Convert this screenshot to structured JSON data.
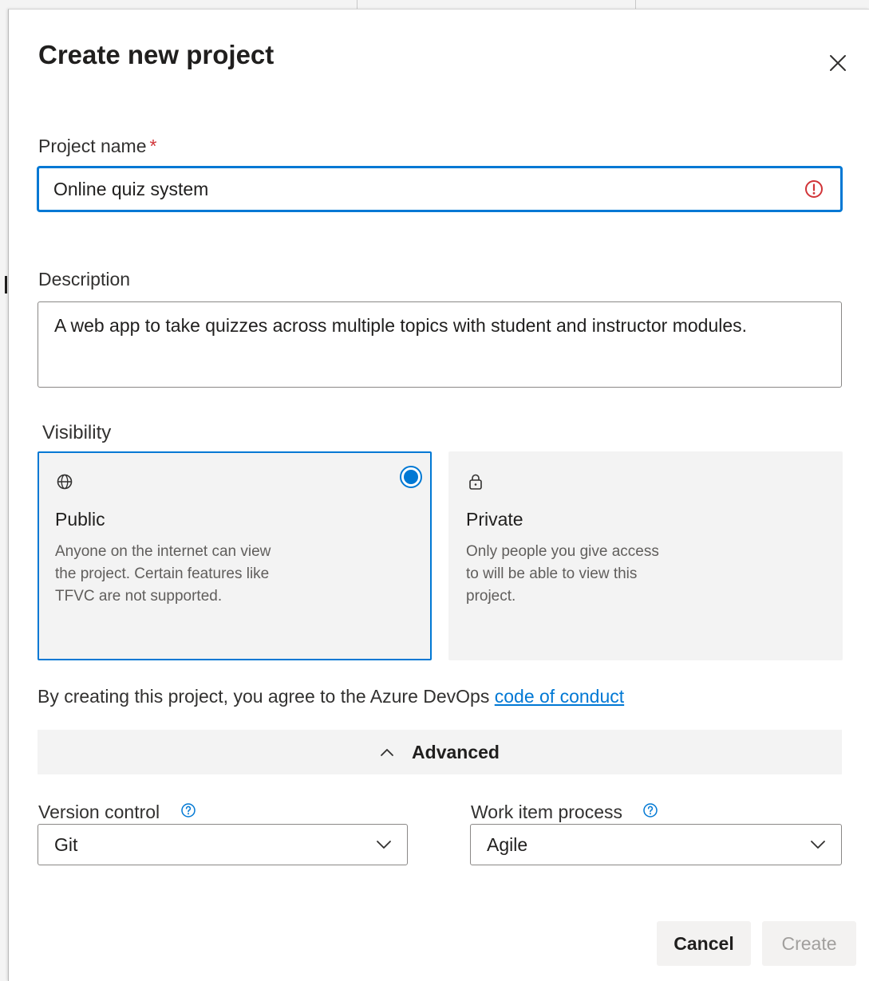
{
  "dialog": {
    "title": "Create new project",
    "close_icon": "close-icon"
  },
  "project_name": {
    "label": "Project name",
    "required_marker": "*",
    "value": "Online quiz system",
    "status_icon": "error-icon"
  },
  "description": {
    "label": "Description",
    "value": "A web app to take quizzes across multiple topics with student and instructor modules."
  },
  "visibility": {
    "label": "Visibility",
    "selected": "Public",
    "options": [
      {
        "icon": "globe-icon",
        "title": "Public",
        "description": "Anyone on the internet can view the project. Certain features like TFVC are not supported."
      },
      {
        "icon": "lock-icon",
        "title": "Private",
        "description": "Only people you give access to will be able to view this project."
      }
    ]
  },
  "agreement": {
    "text": "By creating this project, you agree to the Azure DevOps ",
    "link_text": "code of conduct"
  },
  "advanced": {
    "label": "Advanced",
    "expanded": true,
    "icon": "chevron-up-icon"
  },
  "version_control": {
    "label": "Version control",
    "value": "Git",
    "help_icon": "help-icon"
  },
  "work_item_process": {
    "label": "Work item process",
    "value": "Agile",
    "help_icon": "help-icon"
  },
  "buttons": {
    "cancel": "Cancel",
    "create": "Create",
    "create_enabled": false
  },
  "colors": {
    "accent": "#0078d4",
    "error": "#d13438",
    "card_bg": "#f3f3f3",
    "disabled_text": "#a19f9d"
  }
}
